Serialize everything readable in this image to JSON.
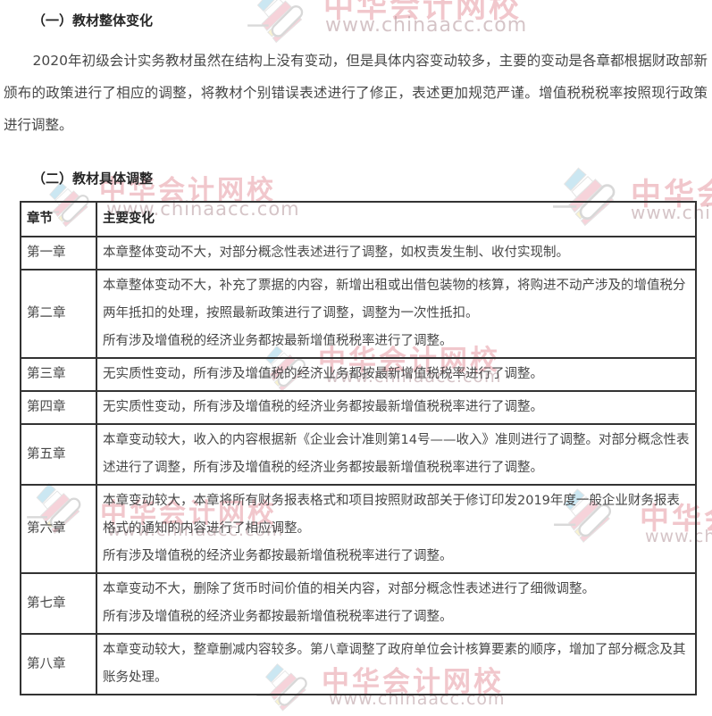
{
  "page": {
    "heading1": "（一）教材整体变化",
    "paragraph": "2020年初级会计实务教材虽然在结构上没有变动，但是具体内容变动较多，主要的变动是各章都根据财政部新颁布的政策进行了相应的调整，将教材个别错误表述进行了修正，表述更加规范严谨。增值税税税率按照现行政策进行调整。",
    "heading2": "（二）教材具体调整"
  },
  "watermark": {
    "brand": "中华会计网校",
    "url": "www.chinaacc.com"
  },
  "colors": {
    "heading": "#262626",
    "text": "#474747",
    "table_border": "#333333",
    "wm_pink": "rgba(224,130,141,0.45)",
    "wm_url": "rgba(178,148,153,0.55)",
    "logo_blue": "#bfe2f0",
    "logo_pink": "#f4c9d1",
    "logo_yellow": "#f8f1c6"
  },
  "table": {
    "headers": [
      "章节",
      "主要变化"
    ],
    "rows": [
      {
        "chapter": "第一章",
        "lines": [
          "本章整体变动不大，对部分概念性表述进行了调整，如权责发生制、收付实现制。"
        ]
      },
      {
        "chapter": "第二章",
        "lines": [
          "本章整体变动不大，补充了票据的内容，新增出租或出借包装物的核算，将购进不动产涉及的增值税分两年抵扣的处理，按照最新政策进行了调整，调整为一次性抵扣。",
          "所有涉及增值税的经济业务都按最新增值税税率进行了调整。"
        ]
      },
      {
        "chapter": "第三章",
        "lines": [
          "无实质性变动，所有涉及增值税的经济业务都按最新增值税税率进行了调整。"
        ]
      },
      {
        "chapter": "第四章",
        "lines": [
          "无实质性变动，所有涉及增值税的经济业务都按最新增值税税率进行了调整。"
        ]
      },
      {
        "chapter": "第五章",
        "lines": [
          "本章变动较大，收入的内容根据新《企业会计准则第14号——收入》准则进行了调整。对部分概念性表述进行了调整，所有涉及增值税的经济业务都按最新增值税税率进行了调整。"
        ]
      },
      {
        "chapter": "第六章",
        "lines": [
          "本章变动较大，本章将所有财务报表格式和项目按照财政部关于修订印发2019年度一般企业财务报表格式的通知的内容进行了相应调整。",
          "所有涉及增值税的经济业务都按最新增值税税率进行了调整。"
        ]
      },
      {
        "chapter": "第七章",
        "lines": [
          "本章变动不大，删除了货币时间价值的相关内容，对部分概念性表述进行了细微调整。",
          "所有涉及增值税的经济业务都按最新增值税税率进行了调整。"
        ]
      },
      {
        "chapter": "第八章",
        "lines": [
          "本章变动较大，整章删减内容较多。第八章调整了政府单位会计核算要素的顺序，增加了部分概念及其账务处理。"
        ]
      }
    ]
  }
}
